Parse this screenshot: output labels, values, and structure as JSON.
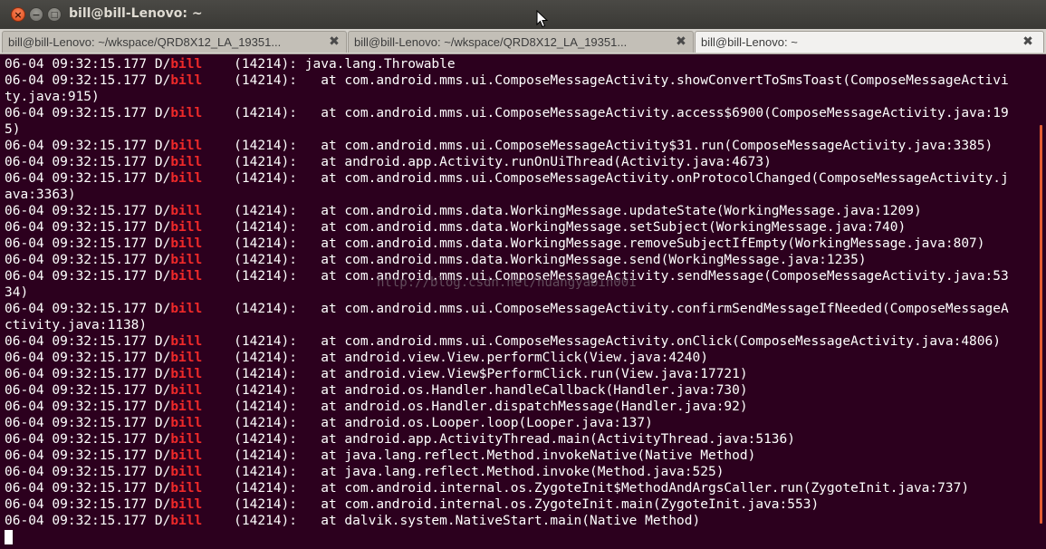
{
  "window": {
    "title": "bill@bill-Lenovo: ~"
  },
  "tabs": [
    {
      "label": "bill@bill-Lenovo: ~/wkspace/QRD8X12_LA_19351..."
    },
    {
      "label": "bill@bill-Lenovo: ~/wkspace/QRD8X12_LA_19351..."
    },
    {
      "label": "bill@bill-Lenovo: ~"
    }
  ],
  "colors": {
    "tag": "#ef2929",
    "terminal_bg": "#2c001e",
    "text": "#ffffff"
  },
  "log": {
    "lines": [
      {
        "prefix": "06-04 09:32:15.177 D/",
        "tag": "bill",
        "pid": "    (14214): ",
        "msg": "java.lang.Throwable"
      },
      {
        "prefix": "06-04 09:32:15.177 D/",
        "tag": "bill",
        "pid": "    (14214): ",
        "msg": "  at com.android.mms.ui.ComposeMessageActivity.showConvertToSmsToast(ComposeMessageActivi",
        "cont": "ty.java:915)"
      },
      {
        "prefix": "06-04 09:32:15.177 D/",
        "tag": "bill",
        "pid": "    (14214): ",
        "msg": "  at com.android.mms.ui.ComposeMessageActivity.access$6900(ComposeMessageActivity.java:19",
        "cont": "5)"
      },
      {
        "prefix": "06-04 09:32:15.177 D/",
        "tag": "bill",
        "pid": "    (14214): ",
        "msg": "  at com.android.mms.ui.ComposeMessageActivity$31.run(ComposeMessageActivity.java:3385)"
      },
      {
        "prefix": "06-04 09:32:15.177 D/",
        "tag": "bill",
        "pid": "    (14214): ",
        "msg": "  at android.app.Activity.runOnUiThread(Activity.java:4673)"
      },
      {
        "prefix": "06-04 09:32:15.177 D/",
        "tag": "bill",
        "pid": "    (14214): ",
        "msg": "  at com.android.mms.ui.ComposeMessageActivity.onProtocolChanged(ComposeMessageActivity.j",
        "cont": "ava:3363)"
      },
      {
        "prefix": "06-04 09:32:15.177 D/",
        "tag": "bill",
        "pid": "    (14214): ",
        "msg": "  at com.android.mms.data.WorkingMessage.updateState(WorkingMessage.java:1209)"
      },
      {
        "prefix": "06-04 09:32:15.177 D/",
        "tag": "bill",
        "pid": "    (14214): ",
        "msg": "  at com.android.mms.data.WorkingMessage.setSubject(WorkingMessage.java:740)"
      },
      {
        "prefix": "06-04 09:32:15.177 D/",
        "tag": "bill",
        "pid": "    (14214): ",
        "msg": "  at com.android.mms.data.WorkingMessage.removeSubjectIfEmpty(WorkingMessage.java:807)"
      },
      {
        "prefix": "06-04 09:32:15.177 D/",
        "tag": "bill",
        "pid": "    (14214): ",
        "msg": "  at com.android.mms.data.WorkingMessage.send(WorkingMessage.java:1235)"
      },
      {
        "prefix": "06-04 09:32:15.177 D/",
        "tag": "bill",
        "pid": "    (14214): ",
        "msg": "  at com.android.mms.ui.ComposeMessageActivity.sendMessage(ComposeMessageActivity.java:53",
        "cont": "34)"
      },
      {
        "prefix": "06-04 09:32:15.177 D/",
        "tag": "bill",
        "pid": "    (14214): ",
        "msg": "  at com.android.mms.ui.ComposeMessageActivity.confirmSendMessageIfNeeded(ComposeMessageA",
        "cont": "ctivity.java:1138)"
      },
      {
        "prefix": "06-04 09:32:15.177 D/",
        "tag": "bill",
        "pid": "    (14214): ",
        "msg": "  at com.android.mms.ui.ComposeMessageActivity.onClick(ComposeMessageActivity.java:4806)"
      },
      {
        "prefix": "06-04 09:32:15.177 D/",
        "tag": "bill",
        "pid": "    (14214): ",
        "msg": "  at android.view.View.performClick(View.java:4240)"
      },
      {
        "prefix": "06-04 09:32:15.177 D/",
        "tag": "bill",
        "pid": "    (14214): ",
        "msg": "  at android.view.View$PerformClick.run(View.java:17721)"
      },
      {
        "prefix": "06-04 09:32:15.177 D/",
        "tag": "bill",
        "pid": "    (14214): ",
        "msg": "  at android.os.Handler.handleCallback(Handler.java:730)"
      },
      {
        "prefix": "06-04 09:32:15.177 D/",
        "tag": "bill",
        "pid": "    (14214): ",
        "msg": "  at android.os.Handler.dispatchMessage(Handler.java:92)"
      },
      {
        "prefix": "06-04 09:32:15.177 D/",
        "tag": "bill",
        "pid": "    (14214): ",
        "msg": "  at android.os.Looper.loop(Looper.java:137)"
      },
      {
        "prefix": "06-04 09:32:15.177 D/",
        "tag": "bill",
        "pid": "    (14214): ",
        "msg": "  at android.app.ActivityThread.main(ActivityThread.java:5136)"
      },
      {
        "prefix": "06-04 09:32:15.177 D/",
        "tag": "bill",
        "pid": "    (14214): ",
        "msg": "  at java.lang.reflect.Method.invokeNative(Native Method)"
      },
      {
        "prefix": "06-04 09:32:15.177 D/",
        "tag": "bill",
        "pid": "    (14214): ",
        "msg": "  at java.lang.reflect.Method.invoke(Method.java:525)"
      },
      {
        "prefix": "06-04 09:32:15.177 D/",
        "tag": "bill",
        "pid": "    (14214): ",
        "msg": "  at com.android.internal.os.ZygoteInit$MethodAndArgsCaller.run(ZygoteInit.java:737)"
      },
      {
        "prefix": "06-04 09:32:15.177 D/",
        "tag": "bill",
        "pid": "    (14214): ",
        "msg": "  at com.android.internal.os.ZygoteInit.main(ZygoteInit.java:553)"
      },
      {
        "prefix": "06-04 09:32:15.177 D/",
        "tag": "bill",
        "pid": "    (14214): ",
        "msg": "  at dalvik.system.NativeStart.main(Native Method)"
      }
    ]
  },
  "watermark": "http://blog.csdn.net/huangyabin001"
}
